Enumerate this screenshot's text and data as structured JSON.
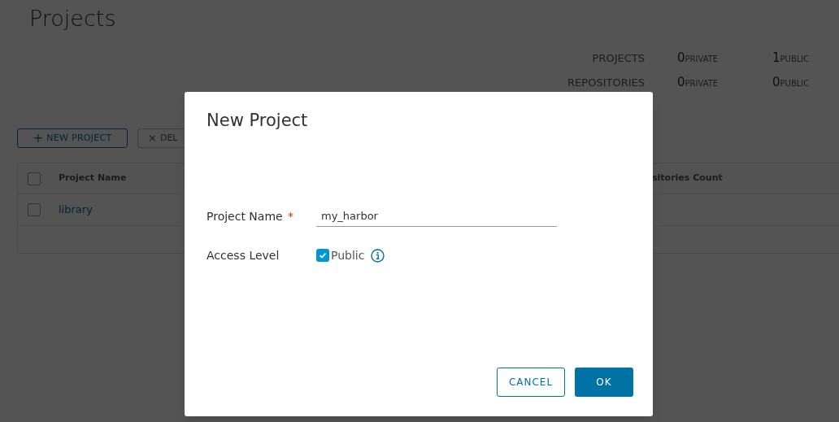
{
  "page": {
    "title": "Projects"
  },
  "stats": [
    {
      "label": "PROJECTS",
      "private_count": "0",
      "private_label": "PRIVATE",
      "public_count": "1",
      "public_label": "PUBLIC"
    },
    {
      "label": "REPOSITORIES",
      "private_count": "0",
      "private_label": "PRIVATE",
      "public_count": "0",
      "public_label": "PUBLIC"
    }
  ],
  "toolbar": {
    "new_icon": "+",
    "new_label": "NEW PROJECT",
    "delete_icon": "×",
    "delete_label": "DEL"
  },
  "table": {
    "columns": [
      "Project Name",
      "sitories Count"
    ],
    "rows": [
      {
        "name": "library",
        "checked": false
      }
    ],
    "header_checked": false
  },
  "dialog": {
    "title": "New Project",
    "fields": [
      {
        "kind": "text",
        "label": "Project Name",
        "required_mark": "*",
        "value": "my_harbor"
      },
      {
        "kind": "checkbox",
        "label": "Access Level",
        "option": "Public",
        "checked": true
      }
    ],
    "buttons": [
      {
        "label": "CANCEL",
        "kind": "outline"
      },
      {
        "label": "OK",
        "kind": "primary"
      }
    ]
  }
}
